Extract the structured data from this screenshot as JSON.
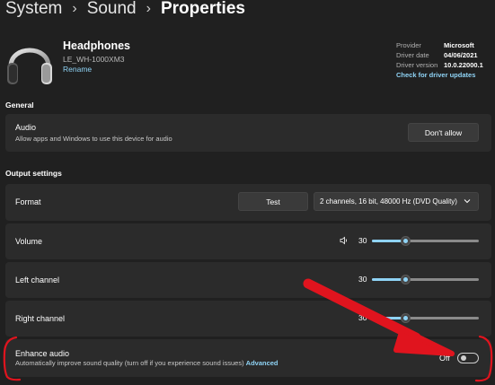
{
  "breadcrumb": [
    "System",
    "Sound",
    "Properties"
  ],
  "device": {
    "icon": "headphones-icon",
    "name": "Headphones",
    "model": "LE_WH-1000XM3",
    "rename_label": "Rename"
  },
  "driver": {
    "provider_label": "Provider",
    "provider_value": "Microsoft",
    "date_label": "Driver date",
    "date_value": "04/06/2021",
    "version_label": "Driver version",
    "version_value": "10.0.22000.1",
    "update_link": "Check for driver updates"
  },
  "general": {
    "title": "General",
    "audio": {
      "label": "Audio",
      "description": "Allow apps and Windows to use this device for audio",
      "button": "Don't allow"
    }
  },
  "output": {
    "title": "Output settings",
    "format": {
      "label": "Format",
      "test_button": "Test",
      "selected": "2 channels, 16 bit, 48000 Hz (DVD Quality)"
    },
    "volume": {
      "label": "Volume",
      "value": "30",
      "level": 0.3
    },
    "left_channel": {
      "label": "Left channel",
      "value": "30",
      "level": 0.3
    },
    "right_channel": {
      "label": "Right channel",
      "value": "30",
      "level": 0.3
    },
    "enhance": {
      "label": "Enhance audio",
      "description": "Automatically improve sound quality (turn off if you experience sound issues)",
      "advanced_link": "Advanced",
      "state": "Off"
    }
  },
  "colors": {
    "background": "#202020",
    "card": "#2b2b2b",
    "accent": "#8fd3f5",
    "annotation": "#e0141e"
  }
}
